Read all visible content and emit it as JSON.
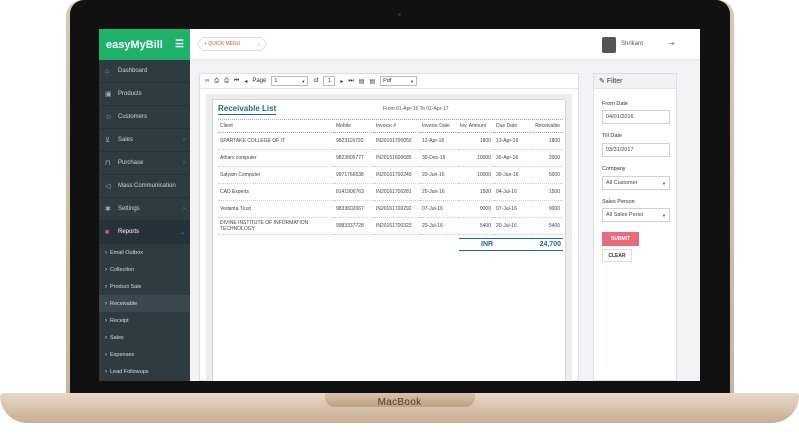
{
  "device": {
    "brand": "MacBook"
  },
  "app": {
    "logo_text": "easyMyBill",
    "colors": {
      "brand": "#1fb26b",
      "sidebar": "#2f3a41",
      "accent": "#1f6b8a",
      "submit": "#e96a7c"
    }
  },
  "sidebar": {
    "items": [
      {
        "label": "Dashboard",
        "icon": "home-icon"
      },
      {
        "label": "Products",
        "icon": "box-icon"
      },
      {
        "label": "Customers",
        "icon": "user-icon"
      },
      {
        "label": "Sales",
        "icon": "cart-icon"
      },
      {
        "label": "Purchase",
        "icon": "bag-icon"
      },
      {
        "label": "Mass Communication",
        "icon": "megaphone-icon"
      },
      {
        "label": "Settings",
        "icon": "gear-icon"
      },
      {
        "label": "Reports",
        "icon": "briefcase-icon"
      }
    ],
    "sub_items": [
      {
        "label": "Email Outbox"
      },
      {
        "label": "Collection"
      },
      {
        "label": "Product Sale"
      },
      {
        "label": "Receivable"
      },
      {
        "label": "Receipt"
      },
      {
        "label": "Sales"
      },
      {
        "label": "Expenses"
      },
      {
        "label": "Lead Followups"
      }
    ]
  },
  "topbar": {
    "quick_menu": "+ QUICK MENU",
    "user_name": "Shrikant"
  },
  "toolbar": {
    "page_label": "Page",
    "page_value": "1",
    "of_label": "of",
    "total_pages": "1",
    "export_format": "Pdf"
  },
  "report": {
    "title": "Receivable List",
    "range": "From  01-Apr-16  To 01-Apr-17",
    "columns": [
      "Client",
      "Mobile",
      "Invoice #",
      "Invoice Date",
      "Inv. Amount",
      "Due Date",
      "Receivable"
    ],
    "rows": [
      [
        "SPARTAKE COLLEGE OF IT",
        "9823116792",
        "IN20161700050",
        "12-Apr-16",
        "1800",
        "13-Apr-16",
        "1800"
      ],
      [
        "Atharv computer",
        "9823809777",
        "IN20151600685",
        "30-Dec-15",
        "10000",
        "30-Apr-16",
        "2000"
      ],
      [
        "Satyam Computer",
        "9971766538",
        "IN20161700240",
        "20-Jun-16",
        "10000",
        "30-Jun-16",
        "5000"
      ],
      [
        "CAD Experts",
        "8141906763",
        "IN20161700281",
        "20-Jun-16",
        "1500",
        "04-Jul-16",
        "1500"
      ],
      [
        "Vedanta Trust",
        "9833602067",
        "IN20161700292",
        "07-Jul-16",
        "9000",
        "07-Jul-16",
        "9000"
      ],
      [
        "DIVINE INSTITUTE OF INFORMATION TECHNOLOGY",
        "9983337728",
        "IN20161700323",
        "20-Jul-16",
        "5400",
        "20-Jul-16",
        "5400"
      ]
    ],
    "total_currency": "INR",
    "total_amount": "24,700"
  },
  "filter": {
    "title": "Filter",
    "from_label": "From Date",
    "from_value": "04/01/2016",
    "till_label": "Till Date",
    "till_value": "03/31/2017",
    "company_label": "Company",
    "company_value": "All Customer",
    "sales_label": "Sales Person",
    "sales_value": "All Sales Perso",
    "submit": "SUBMIT",
    "clear": "CLEAR"
  }
}
